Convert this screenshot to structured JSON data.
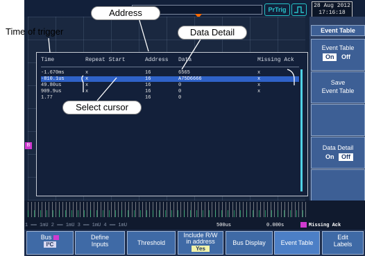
{
  "header": {
    "trigger_mode": "PrTrig",
    "date": "28 Aug 2012",
    "time": "17:16:18"
  },
  "annotations": {
    "address": "Address",
    "time_of_trigger": "Time of trigger",
    "data_detail": "Data Detail",
    "select_cursor": "Select cursor"
  },
  "event_table": {
    "columns": [
      "Time",
      "Repeat Start",
      "Address",
      "Data",
      "Missing Ack"
    ],
    "rows": [
      {
        "time": "-1.670ms",
        "repeat_start": "x",
        "address": "16",
        "data": "6565",
        "missing_ack": "x",
        "selected": false
      },
      {
        "time": "-810.1us",
        "repeat_start": "x",
        "address": "16",
        "data": "A75D6666",
        "missing_ack": "x",
        "selected": true
      },
      {
        "time": "49.80us",
        "repeat_start": "x",
        "address": "16",
        "data": "0",
        "missing_ack": "x",
        "selected": false
      },
      {
        "time": "909.9us",
        "repeat_start": "x",
        "address": "16",
        "data": "0",
        "missing_ack": "x",
        "selected": false
      },
      {
        "time": "1.77",
        "repeat_start": "",
        "address": "16",
        "data": "0",
        "missing_ack": "",
        "selected": false
      }
    ]
  },
  "sidebar": {
    "title": "Event Table",
    "event_table_label": "Event Table",
    "on": "On",
    "off": "Off",
    "save_label_1": "Save",
    "save_label_2": "Event Table",
    "data_detail_label": "Data Detail",
    "dd_on": "On",
    "dd_off": "Off"
  },
  "status": {
    "ch_scales": "1 ══ 1mU    2 ══ 1mU    3 ══ 1mU    4 ══ 1mU",
    "timebase": "500us",
    "trig_position": "0.000s",
    "trigger_event": "Missing Ack"
  },
  "softkeys": {
    "bus": "Bus",
    "bus_type": "I²C",
    "define_inputs_1": "Define",
    "define_inputs_2": "Inputs",
    "threshold": "Threshold",
    "include_rw_1": "Include R/W",
    "include_rw_2": "in address",
    "include_rw_value": "Yes",
    "bus_display": "Bus Display",
    "event_table": "Event Table",
    "edit_labels_1": "Edit",
    "edit_labels_2": "Labels"
  },
  "colors": {
    "selection": "#2f62c8",
    "channel_marker": "#d03ad0",
    "accent_cyan": "#27c3c9"
  }
}
